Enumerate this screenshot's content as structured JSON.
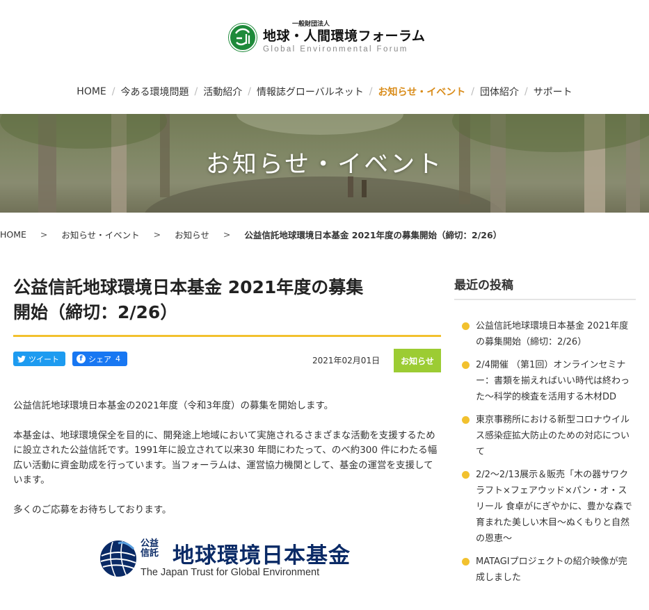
{
  "brand": {
    "sub_label": "一般財団法人",
    "name": "地球・人間環境フォーラム",
    "english_name": "Global Environmental Forum"
  },
  "nav": {
    "items": [
      {
        "label": "HOME",
        "active": false
      },
      {
        "label": "今ある環境問題",
        "active": false
      },
      {
        "label": "活動紹介",
        "active": false
      },
      {
        "label": "情報誌グローバルネット",
        "active": false
      },
      {
        "label": "お知らせ・イベント",
        "active": true
      },
      {
        "label": "団体紹介",
        "active": false
      },
      {
        "label": "サポート",
        "active": false
      }
    ],
    "separator": "/",
    "active_color": "#d98c1a"
  },
  "hero": {
    "title": "お知らせ・イベント"
  },
  "breadcrumb": {
    "items": [
      "HOME",
      "お知らせ・イベント",
      "お知らせ"
    ],
    "current": "公益信託地球環境日本基金 2021年度の募集開始（締切：2/26）",
    "separator": ">"
  },
  "article": {
    "title_line1": "公益信託地球環境日本基金 2021年度の募集",
    "title_line2": "開始（締切：2/26）",
    "share": {
      "tweet_label": "ツイート",
      "facebook_label": "シェア",
      "facebook_count": "4"
    },
    "date": "2021年02月01日",
    "category": "お知らせ",
    "paragraphs": [
      "公益信託地球環境日本基金の2021年度（令和3年度）の募集を開始します。",
      "本基金は、地球環境保全を目的に、開発途上地域において実施されるさまざまな活動を支援するために設立された公益信託です。1991年に設立されて以来30 年間にわたって、のべ約300 件にわたる幅広い活動に資金助成を行っています。当フォーラムは、運営協力機関として、基金の運営を支援しています。",
      "多くのご応募をお待ちしております。"
    ],
    "fund_logo": {
      "small_label": "公益信託",
      "name": "地球環境日本基金",
      "english": "The Japan Trust for Global Environment"
    }
  },
  "sidebar": {
    "heading": "最近の投稿",
    "recent_posts": [
      "公益信託地球環境日本基金 2021年度の募集開始（締切：2/26）",
      "2/4開催 （第1回）オンラインセミナー：書類を揃えればいい時代は終わった〜科学的検査を活用する木材DD",
      "東京事務所における新型コロナウイルス感染症拡大防止のための対応について",
      "2/2〜2/13展示＆販売「木の器サワクラフト×フェアウッド×パン・オ・スリール 食卓がにぎやかに、豊かな森で育まれた美しい木目〜ぬくもりと自然の恩恵〜",
      "MATAGIプロジェクトの紹介映像が完成しました"
    ]
  },
  "colors": {
    "accent_yellow": "#f2c12e",
    "category_green": "#9ccc33",
    "twitter_blue": "#1d9bf0",
    "facebook_blue": "#1877f2",
    "logo_green": "#1e8a3a",
    "fund_navy": "#0a2a66"
  },
  "icons": {
    "tweet": "twitter-bird-icon",
    "share": "facebook-f-icon",
    "logo": "gef-globe-logo-icon",
    "bullet": "circle-bullet-icon"
  }
}
